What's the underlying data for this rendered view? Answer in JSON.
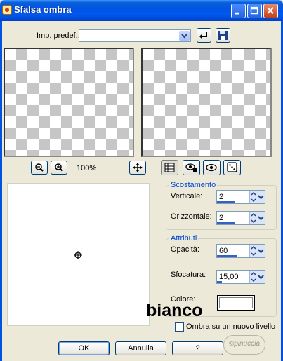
{
  "window": {
    "title": "Sfalsa ombra"
  },
  "preset": {
    "label": "Imp. predef.:",
    "value": ""
  },
  "zoom": {
    "level": "100%"
  },
  "offset": {
    "legend": "Scostamento",
    "vertical_label": "Verticale:",
    "vertical_value": "2",
    "vertical_fraction": 0.55,
    "horizontal_label": "Orizzontale:",
    "horizontal_value": "2",
    "horizontal_fraction": 0.55
  },
  "attributes": {
    "legend": "Attributi",
    "opacity_label": "Opacità:",
    "opacity_value": "60",
    "opacity_fraction": 0.6,
    "blur_label": "Sfocatura:",
    "blur_value": "15,00",
    "blur_fraction": 0.15,
    "color_label": "Colore:",
    "color_value": "#ffffff"
  },
  "annotation": {
    "text": "bianco"
  },
  "new_layer": {
    "label": "Ombra su un nuovo livello",
    "checked": false
  },
  "buttons": {
    "ok": "OK",
    "cancel": "Annulla",
    "help": "?"
  },
  "watermark": {
    "text": "©pinuccia"
  },
  "colors": {
    "titlebar": "#0054e3",
    "window_bg": "#ece9d8",
    "group_legend": "#0046d5"
  }
}
